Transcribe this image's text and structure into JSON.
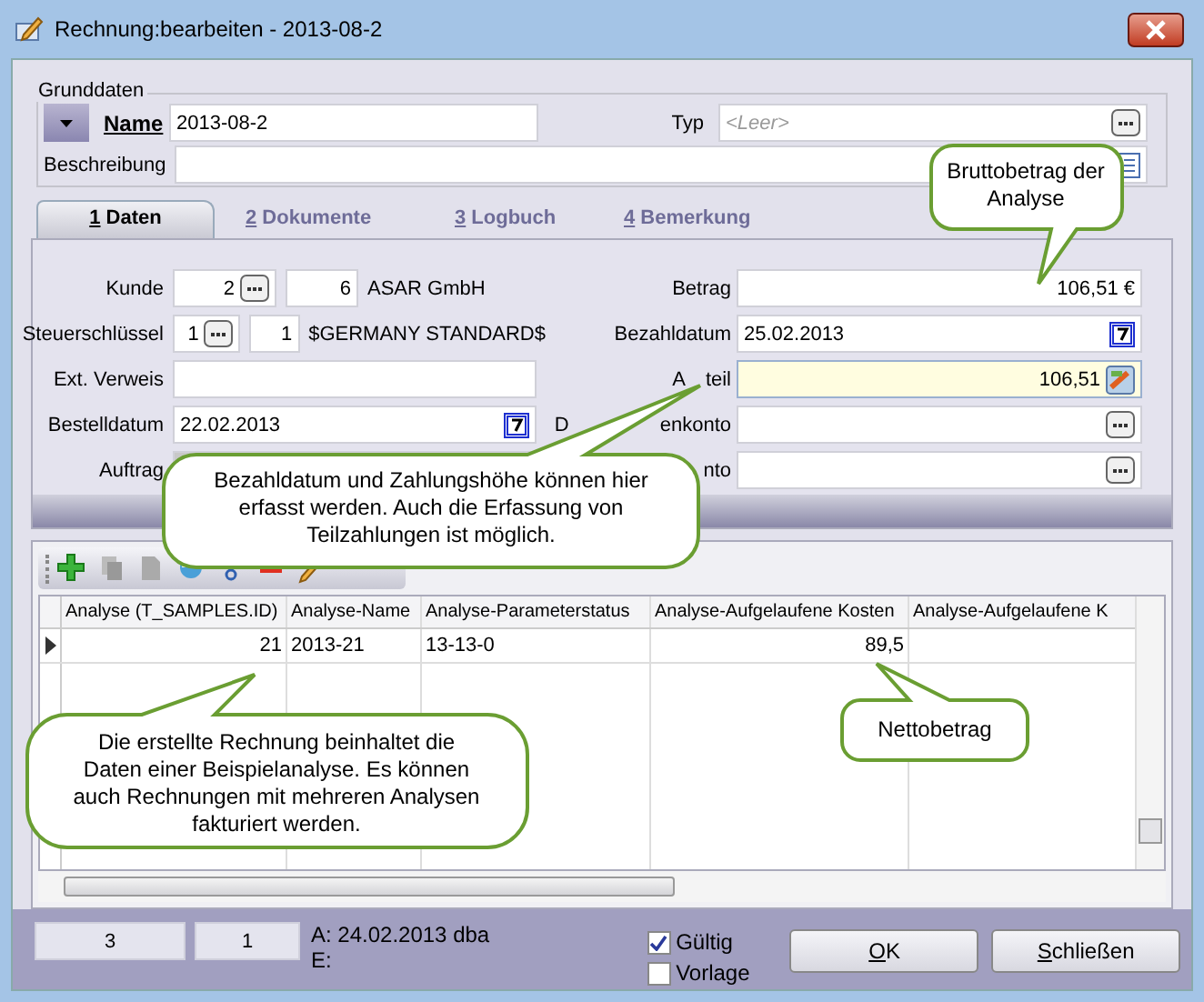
{
  "window": {
    "title": "Rechnung:bearbeiten - 2013-08-2"
  },
  "grunddaten": {
    "title": "Grunddaten",
    "name_label": "Name",
    "name_value": "2013-08-2",
    "typ_label": "Typ",
    "typ_placeholder": "<Leer>",
    "beschreibung_label": "Beschreibung"
  },
  "tabs": [
    {
      "accel": "1",
      "label": " Daten",
      "selected": true
    },
    {
      "accel": "2",
      "label": " Dokumente",
      "selected": false
    },
    {
      "accel": "3",
      "label": " Logbuch",
      "selected": false
    },
    {
      "accel": "4",
      "label": " Bemerkung",
      "selected": false
    }
  ],
  "left_fields": [
    {
      "kind": "lookup",
      "label": "Kunde",
      "id": "2",
      "code": "6",
      "text": "ASAR GmbH"
    },
    {
      "kind": "lookup",
      "label": "Steuerschlüssel",
      "id": "1",
      "code": "1",
      "text": "$GERMANY STANDARD$"
    },
    {
      "kind": "text",
      "label": "Ext. Verweis"
    },
    {
      "kind": "date",
      "label": "Bestelldatum",
      "value": "22.02.2013"
    },
    {
      "kind": "disabled",
      "label": "Auftrag"
    }
  ],
  "right_fields": [
    {
      "kind": "amount",
      "label_parts": [
        "Betrag"
      ],
      "value": "106,51 €",
      "highlighted": false
    },
    {
      "kind": "date",
      "label_parts": [
        "Bezahldatum"
      ],
      "value": "25.02.2013",
      "highlighted": false
    },
    {
      "kind": "calc",
      "label_parts": [
        "A",
        "teil"
      ],
      "value": "106,51",
      "highlighted": true
    },
    {
      "kind": "lookup",
      "label_parts": [
        "D",
        "enkonto"
      ],
      "highlighted": false
    },
    {
      "kind": "lookup",
      "label_parts": [
        "nto"
      ],
      "highlighted": false
    }
  ],
  "grid": {
    "columns": [
      "Analyse (T_SAMPLES.ID)",
      "Analyse-Name",
      "Analyse-Parameterstatus",
      "Analyse-Aufgelaufene Kosten",
      "Analyse-Aufgelaufene K"
    ],
    "rows": [
      {
        "selected": true,
        "cells": [
          "21",
          "2013-21",
          "13-13-0",
          "89,5",
          ""
        ]
      }
    ]
  },
  "footer": {
    "counters": [
      "3",
      "1"
    ],
    "created": "A: 24.02.2013 dba",
    "edited": "E:",
    "checkboxes": [
      {
        "label": "Gültig",
        "checked": true
      },
      {
        "label": "Vorlage",
        "checked": false
      }
    ],
    "buttons": [
      {
        "accel": "O",
        "rest": "K"
      },
      {
        "accel": "S",
        "rest": "chließen"
      }
    ]
  },
  "callouts": [
    {
      "lines": [
        "Bruttobetrag der",
        "Analyse"
      ]
    },
    {
      "lines": [
        "Bezahldatum und Zahlungshöhe können hier",
        "erfasst werden. Auch die Erfassung von",
        "Teilzahlungen ist möglich."
      ]
    },
    {
      "lines": [
        "Die erstellte Rechnung beinhaltet die",
        "Daten einer Beispielanalyse. Es können",
        "auch Rechnungen mit mehreren Analysen",
        "fakturiert werden."
      ]
    },
    {
      "lines": [
        "Nettobetrag"
      ]
    }
  ]
}
